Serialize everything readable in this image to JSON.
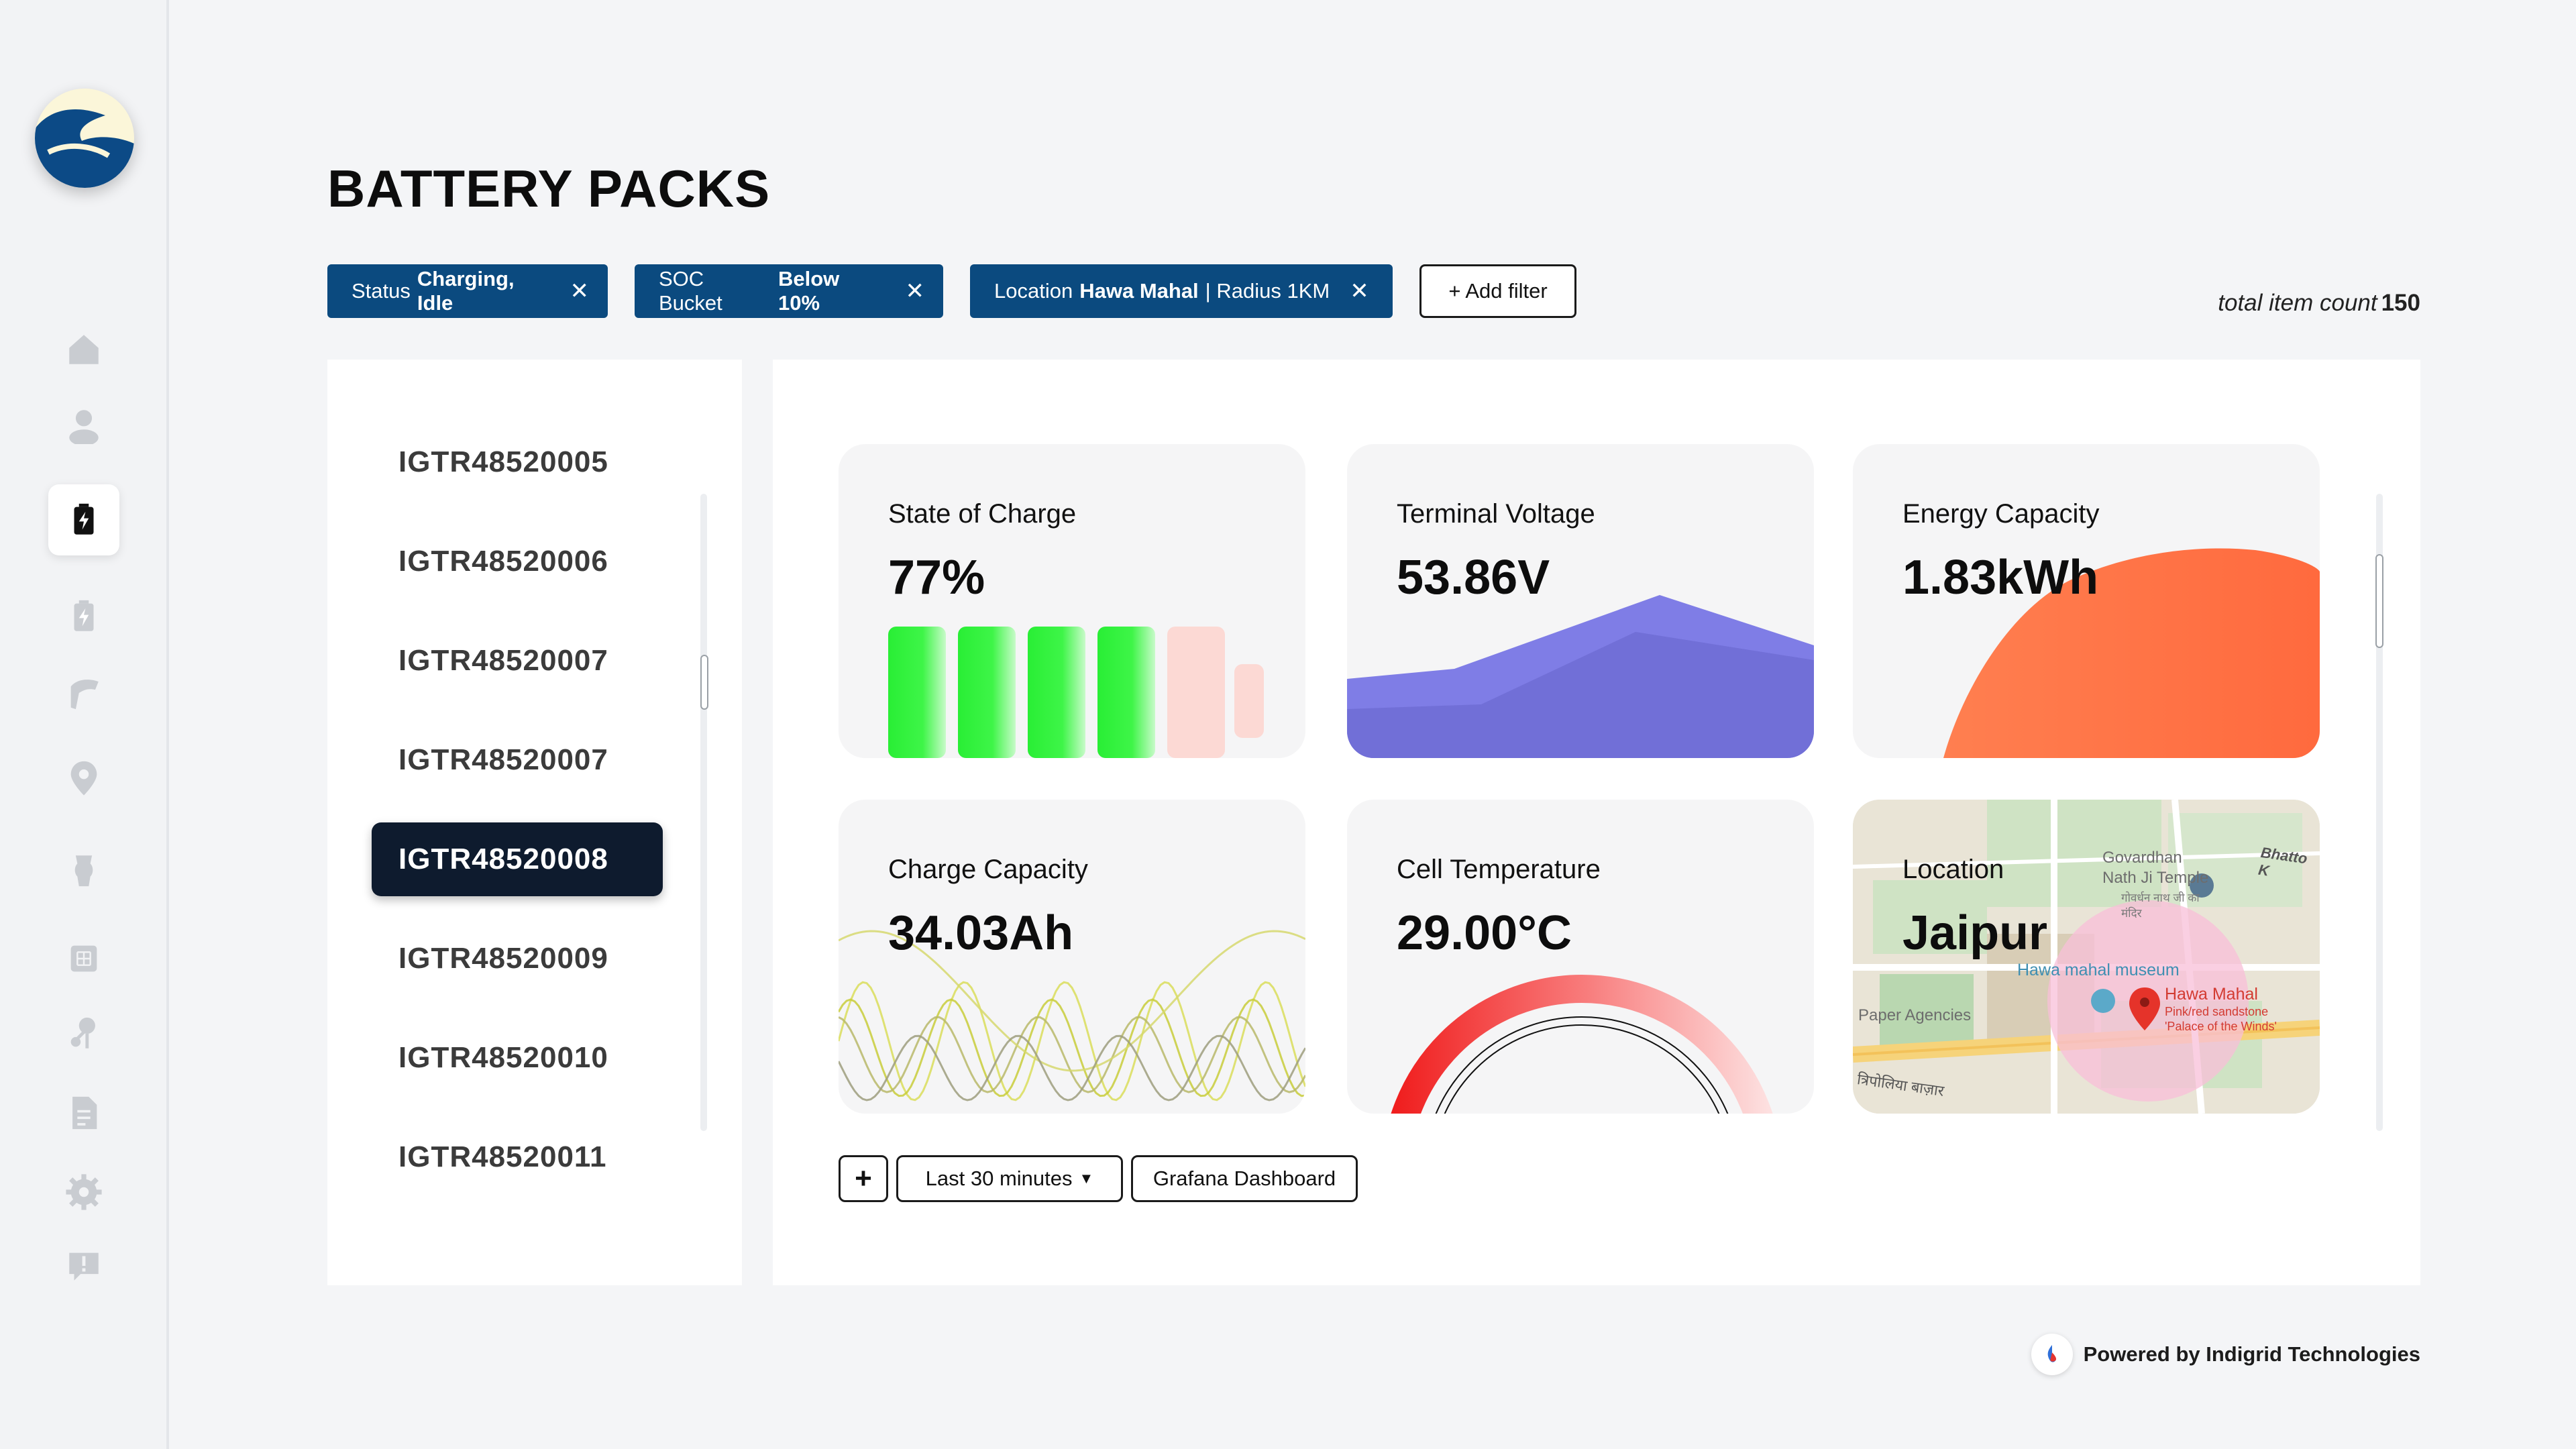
{
  "page": {
    "title": "BATTERY PACKS"
  },
  "filters": [
    {
      "key": "Status",
      "value": "Charging, Idle"
    },
    {
      "key": "SOC Bucket",
      "value": "Below 10%"
    },
    {
      "key": "Location",
      "value": "Hawa Mahal",
      "extra": "| Radius 1KM"
    }
  ],
  "add_filter_label": "+ Add filter",
  "total": {
    "label": "total item count",
    "value": "150"
  },
  "battery_list": [
    "IGTR48520005",
    "IGTR48520006",
    "IGTR48520007",
    "IGTR48520007",
    "IGTR48520008",
    "IGTR48520009",
    "IGTR48520010",
    "IGTR48520011"
  ],
  "selected_index": 4,
  "cards": {
    "soc": {
      "title": "State of Charge",
      "value": "77%",
      "level_bars_filled": 4,
      "level_bars_total": 6
    },
    "voltage": {
      "title": "Terminal Voltage",
      "value": "53.86V"
    },
    "energy": {
      "title": "Energy Capacity",
      "value": "1.83kWh"
    },
    "charge": {
      "title": "Charge Capacity",
      "value": "34.03Ah"
    },
    "temperature": {
      "title": "Cell Temperature",
      "value": "29.00°C"
    },
    "location": {
      "title": "Location",
      "value": "Jaipur",
      "map_labels": {
        "temple_en": "Govardhan Nath Ji Temple",
        "temple_hi": "गोवर्धन नाथ जी का मंदिर",
        "museum": "Hawa mahal museum",
        "hawa_mahal": "Hawa Mahal",
        "hawa_sub1": "Pink/red sandstone",
        "hawa_sub2": "'Palace of the Winds'",
        "agencies": "Paper Agencies",
        "bazaar": "त्रिपोलिया बाज़ार",
        "bhatto": "Bhatto K"
      }
    }
  },
  "controls": {
    "add": "+",
    "time_range": "Last 30 minutes",
    "grafana": "Grafana Dashboard"
  },
  "footer": {
    "powered_by": "Powered by Indigrid Technologies"
  },
  "colors": {
    "chip_bg": "#0b4a7f",
    "selected_bg": "#0e1b2e",
    "soc_green": "#2ef23a",
    "voltage_purple": "#7472dd",
    "energy_orange": "#ff7a4c",
    "temp_red": "#f02a2a"
  }
}
